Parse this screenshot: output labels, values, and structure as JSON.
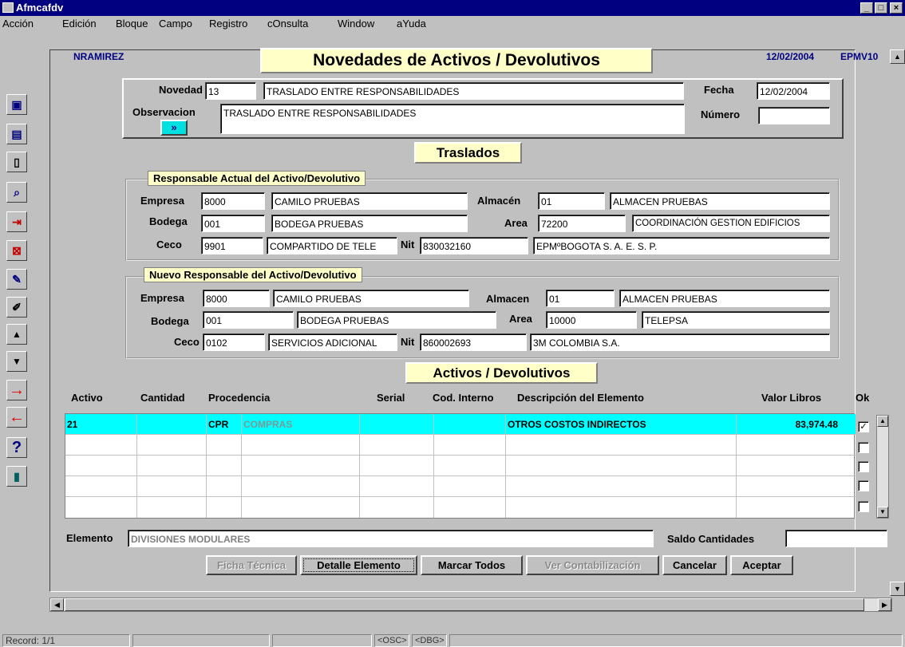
{
  "window": {
    "title": "Afmcafdv",
    "min": "_",
    "max": "□",
    "close": "×"
  },
  "menu": [
    "Acción",
    "Edición",
    "Bloque",
    "Campo",
    "Registro",
    "cOnsulta",
    "Window",
    "aYuda"
  ],
  "header": {
    "user": "NRAMIREZ",
    "title": "Novedades de Activos / Devolutivos",
    "date": "12/02/2004",
    "db": "EPMV10"
  },
  "novedad": {
    "novedad_label": "Novedad",
    "novedad_code": "13",
    "novedad_desc": "TRASLADO ENTRE RESPONSABILIDADES",
    "fecha_label": "Fecha",
    "fecha_value": "12/02/2004",
    "observacion_label": "Observacion",
    "observacion_value": "TRASLADO ENTRE RESPONSABILIDADES",
    "numero_label": "Número",
    "numero_value": ""
  },
  "traslados_title": "Traslados",
  "actual": {
    "title": "Responsable Actual del Activo/Devolutivo",
    "empresa_label": "Empresa",
    "empresa_code": "8000",
    "empresa_name": "CAMILO PRUEBAS",
    "almacen_label": "Almacén",
    "almacen_code": "01",
    "almacen_name": "ALMACEN PRUEBAS",
    "bodega_label": "Bodega",
    "bodega_code": "001",
    "bodega_name": "BODEGA PRUEBAS",
    "area_label": "Area",
    "area_code": "72200",
    "area_name": "COORDINACIÓN GESTION EDIFICIOS",
    "ceco_label": "Ceco",
    "ceco_code": "9901",
    "ceco_name": "COMPARTIDO DE TELE",
    "nit_label": "Nit",
    "nit_code": "830032160",
    "nit_name": "EPMºBOGOTA S. A. E. S. P."
  },
  "nuevo": {
    "title": "Nuevo Responsable del Activo/Devolutivo",
    "empresa_label": "Empresa",
    "empresa_code": "8000",
    "empresa_name": "CAMILO PRUEBAS",
    "almacen_label": "Almacen",
    "almacen_code": "01",
    "almacen_name": "ALMACEN PRUEBAS",
    "bodega_label": "Bodega",
    "bodega_code": "001",
    "bodega_name": "BODEGA PRUEBAS",
    "area_label": "Area",
    "area_code": "10000",
    "area_name": "TELEPSA",
    "ceco_label": "Ceco",
    "ceco_code": "0102",
    "ceco_name": "SERVICIOS ADICIONAL",
    "nit_label": "Nit",
    "nit_code": "860002693",
    "nit_name": "3M COLOMBIA S.A."
  },
  "activos_title": "Activos / Devolutivos",
  "table": {
    "columns": [
      "Activo",
      "Cantidad",
      "Procedencia",
      "Serial",
      "Cod. Interno",
      "Descripción del Elemento",
      "Valor Libros",
      "Ok"
    ],
    "rows": [
      {
        "activo": "21",
        "cantidad": "",
        "proc_code": "CPR",
        "proc_desc": "COMPRAS",
        "serial": "",
        "cod_interno": "",
        "descripcion": "OTROS COSTOS INDIRECTOS",
        "valor": "83,974.48",
        "ok": true
      },
      {
        "activo": "",
        "cantidad": "",
        "proc_code": "",
        "proc_desc": "",
        "serial": "",
        "cod_interno": "",
        "descripcion": "",
        "valor": "",
        "ok": false
      },
      {
        "activo": "",
        "cantidad": "",
        "proc_code": "",
        "proc_desc": "",
        "serial": "",
        "cod_interno": "",
        "descripcion": "",
        "valor": "",
        "ok": false
      },
      {
        "activo": "",
        "cantidad": "",
        "proc_code": "",
        "proc_desc": "",
        "serial": "",
        "cod_interno": "",
        "descripcion": "",
        "valor": "",
        "ok": false
      },
      {
        "activo": "",
        "cantidad": "",
        "proc_code": "",
        "proc_desc": "",
        "serial": "",
        "cod_interno": "",
        "descripcion": "",
        "valor": "",
        "ok": false
      }
    ]
  },
  "elemento": {
    "label": "Elemento",
    "value": "DIVISIONES MODULARES"
  },
  "saldo": {
    "label": "Saldo Cantidades",
    "value": ""
  },
  "buttons": {
    "ficha": "Ficha Técnica",
    "detalle": "Detalle Elemento",
    "marcar": "Marcar Todos",
    "ver": "Ver Contabilización",
    "cancelar": "Cancelar",
    "aceptar": "Aceptar"
  },
  "status": {
    "record": "Record: 1/1",
    "osc": "<OSC>",
    "dbg": "<DBG>"
  },
  "toolbar_icons": [
    "save-icon",
    "list-icon",
    "clipboard-icon",
    "query-icon",
    "insert-record-icon",
    "delete-record-icon",
    "clear-icon",
    "edit-icon",
    "previous-icon",
    "next-icon",
    "forward-arrow-icon",
    "back-arrow-icon",
    "help-icon",
    "exit-icon"
  ],
  "colors": {
    "title_bg": "#000080",
    "window_bg": "#c0c0c0",
    "highlight_row": "#00ffff",
    "label_box": "#ffffc8"
  }
}
